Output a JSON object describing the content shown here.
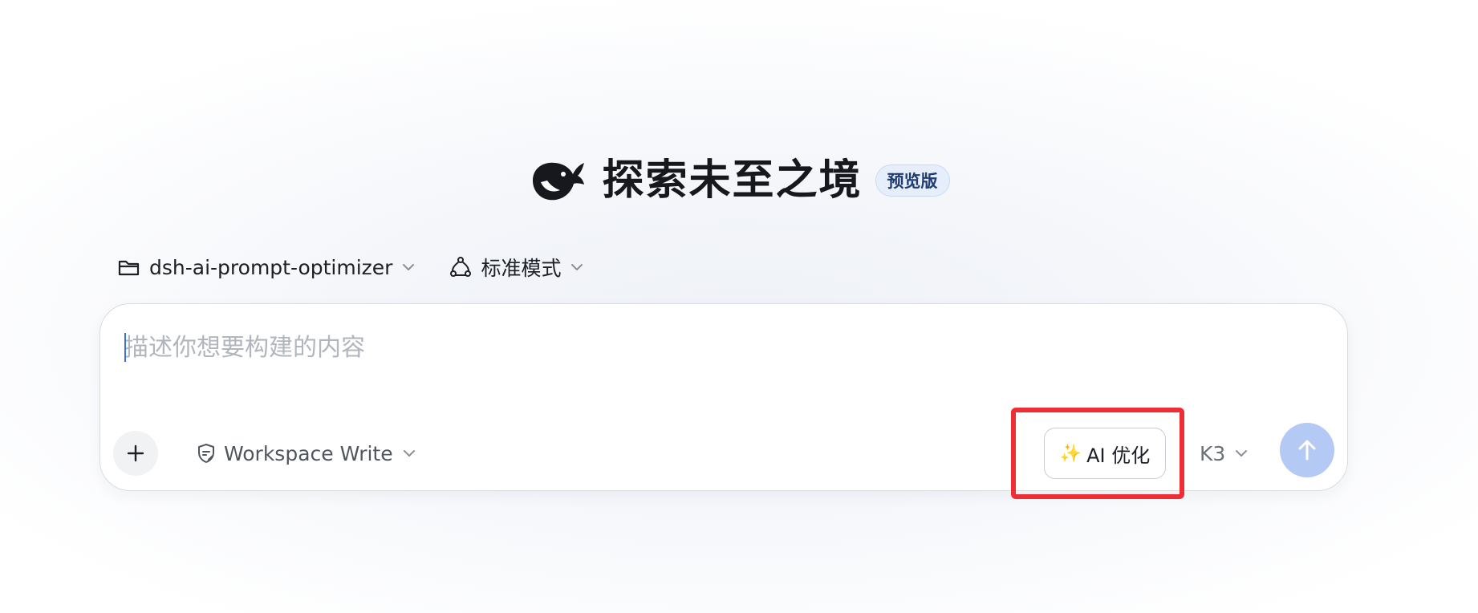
{
  "hero": {
    "logo_icon": "whale-logo-icon",
    "title": "探索未至之境",
    "badge": "预览版"
  },
  "selectors": {
    "project": {
      "icon": "folder-icon",
      "label": "dsh-ai-prompt-optimizer"
    },
    "mode": {
      "icon": "mode-nodes-icon",
      "label": "标准模式"
    }
  },
  "composer": {
    "placeholder": "描述你想要构建的内容",
    "value": "",
    "add_icon": "plus-icon",
    "permission": {
      "icon": "shield-edit-icon",
      "label": "Workspace Write"
    },
    "ai_optimize": {
      "icon": "sparkles-icon",
      "spark": "✨",
      "label": "AI 优化"
    },
    "model": {
      "label": "K3"
    },
    "send_icon": "arrow-up-icon"
  },
  "colors": {
    "accent": "#3a6fe3",
    "send_button": "#b5c9f5",
    "badge_bg": "#e6eefb",
    "badge_text": "#1f3b73",
    "highlight": "#ee2e34"
  }
}
